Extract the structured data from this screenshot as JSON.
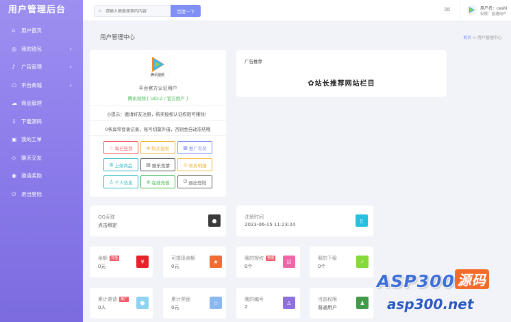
{
  "brand": "用户管理后台",
  "sidebar": {
    "items": [
      {
        "label": "用户首页",
        "icon": "home-icon",
        "glyph": "⌂",
        "chevron": false
      },
      {
        "label": "我的钱包",
        "icon": "wallet-icon",
        "glyph": "◎",
        "chevron": true
      },
      {
        "label": "广告管理",
        "icon": "bell-icon",
        "glyph": "♪",
        "chevron": true
      },
      {
        "label": "平台商城",
        "icon": "cart-icon",
        "glyph": "☖",
        "chevron": true
      },
      {
        "label": "商品管理",
        "icon": "cloud-icon",
        "glyph": "☁",
        "chevron": false
      },
      {
        "label": "下载源码",
        "icon": "download-icon",
        "glyph": "⇩",
        "chevron": false
      },
      {
        "label": "我的工单",
        "icon": "ticket-icon",
        "glyph": "▣",
        "chevron": false
      },
      {
        "label": "聊天交友",
        "icon": "chat-icon",
        "glyph": "◇",
        "chevron": false
      },
      {
        "label": "邀请奖励",
        "icon": "gift-icon",
        "glyph": "◉",
        "chevron": false
      },
      {
        "label": "退出登陆",
        "icon": "power-icon",
        "glyph": "⏻",
        "chevron": false
      }
    ]
  },
  "search": {
    "placeholder": "请输入需要搜索的内容",
    "button": "百度一下"
  },
  "user": {
    "name": "用户名：ceshi",
    "role": "权限：普通用户"
  },
  "page": {
    "title": "用户管理中心",
    "crumb_home": "首页",
    "crumb_sep": ">",
    "crumb_current": "用户管理中心"
  },
  "profile": {
    "cert": "平台官方认证用户",
    "tag": "腾讯视频 [ UID:2 / 官方用户 ]",
    "tip": "小提示：邀请好友注册，购买授权认证权限可赚钱！",
    "notice": "0条异常登录记录，账号切莫外借，否则会自动冻结哦",
    "logo_text": "腾讯视频"
  },
  "actions": [
    {
      "label": "每日签到",
      "glyph": "☆",
      "color": "#f25c69"
    },
    {
      "label": "购买授权",
      "glyph": "◈",
      "color": "#f0b43c"
    },
    {
      "label": "推广有奖",
      "glyph": "▦",
      "color": "#7f8ff5"
    },
    {
      "label": "上架商品",
      "glyph": "⊞",
      "color": "#2eb8c7"
    },
    {
      "label": "娱乐竞猜",
      "glyph": "▤",
      "color": "#555555"
    },
    {
      "label": "收支明细",
      "glyph": "◎",
      "color": "#f0b43c"
    },
    {
      "label": "个人信息",
      "glyph": "♙",
      "color": "#2eb8c7"
    },
    {
      "label": "在线充值",
      "glyph": "⊛",
      "color": "#3fb950"
    },
    {
      "label": "退出登陆",
      "glyph": "⏻",
      "color": "#666666"
    }
  ],
  "ad": {
    "title": "广告推荐",
    "banner": "站长推荐网站栏目",
    "banner_glyph": "✿"
  },
  "stats": [
    {
      "label": "QQ互联",
      "value": "点击绑定",
      "tag": "",
      "tag_color": "",
      "icon": "qq-icon",
      "glyph": "●",
      "icon_color": "#3a3a3a"
    },
    {
      "label": "注册时间",
      "value": "2023-06-15 11:23:24",
      "tag": "",
      "tag_color": "",
      "icon": "tablet-icon",
      "glyph": "▯",
      "icon_color": "#27c0de"
    },
    {
      "label": "余额",
      "value": "0元",
      "tag": "充值",
      "tag_color": "#f25c69",
      "icon": "yen-icon",
      "glyph": "¥",
      "icon_color": "#e8202a"
    },
    {
      "label": "可提现余额",
      "value": "0元",
      "tag": "",
      "tag_color": "",
      "icon": "star-icon",
      "glyph": "★",
      "icon_color": "#f26b30"
    },
    {
      "label": "我的授权",
      "value": "0个",
      "tag": "管理",
      "tag_color": "#f25c69",
      "icon": "check-doc-icon",
      "glyph": "☑",
      "icon_color": "#f066a7"
    },
    {
      "label": "我的下级",
      "value": "0个",
      "tag": "",
      "tag_color": "",
      "icon": "check-circle-icon",
      "glyph": "✓",
      "icon_color": "#86d93a"
    },
    {
      "label": "累计邀请",
      "value": "0人",
      "tag": "推广",
      "tag_color": "#f25c69",
      "icon": "cube-icon",
      "glyph": "⬢",
      "icon_color": "#8fd3f0"
    },
    {
      "label": "累计奖励",
      "value": "0元",
      "tag": "",
      "tag_color": "",
      "icon": "star-outline-icon",
      "glyph": "☆",
      "icon_color": "#8ab8f0"
    },
    {
      "label": "我的编号",
      "value": "2",
      "tag": "",
      "tag_color": "",
      "icon": "user-icon",
      "glyph": "♙",
      "icon_color": "#8e6fe0"
    },
    {
      "label": "当前权限",
      "value": "普通用户",
      "tag": "",
      "tag_color": "",
      "icon": "person-icon",
      "glyph": "♟",
      "icon_color": "#3f9b4a"
    }
  ],
  "watermark": {
    "line1_a": "ASP300",
    "line1_b": "源码",
    "line2": "asp300.net"
  }
}
